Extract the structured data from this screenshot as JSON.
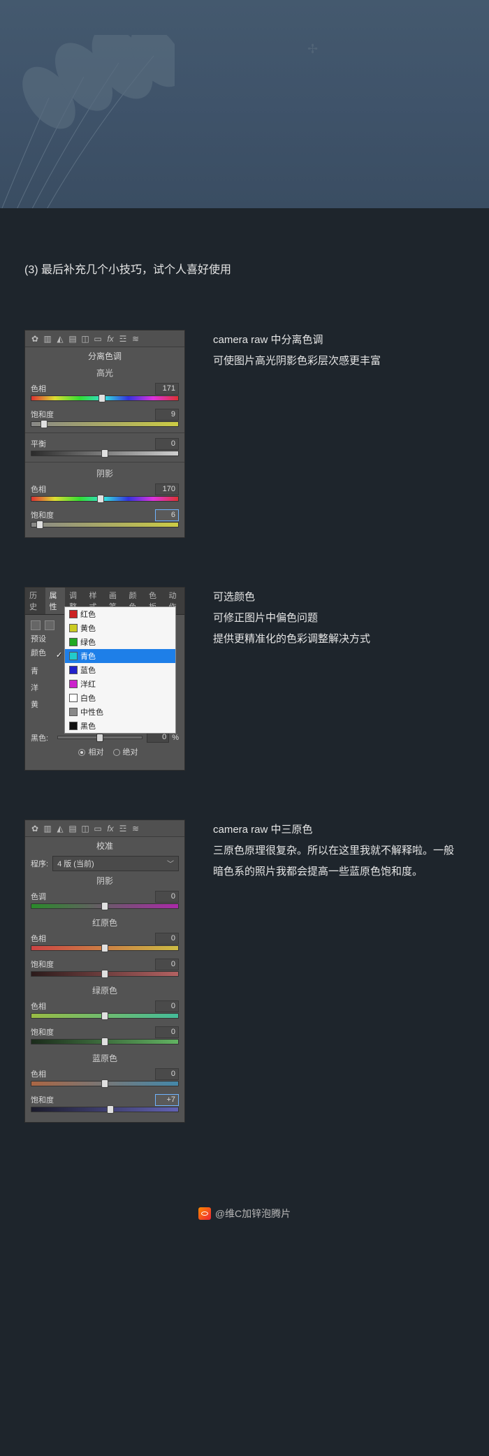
{
  "intro": "(3) 最后补充几个小技巧，试个人喜好使用",
  "split_toning_panel": {
    "title": "分离色调",
    "highlights_label": "高光",
    "shadows_label": "阴影",
    "hue_label": "色相",
    "saturation_label": "饱和度",
    "balance_label": "平衡",
    "highlight_hue": "171",
    "highlight_saturation": "9",
    "balance": "0",
    "shadow_hue": "170",
    "shadow_saturation": "6"
  },
  "split_toning_desc": {
    "line1": "camera raw 中分离色调",
    "line2": "可使图片高光阴影色彩层次感更丰富"
  },
  "selective_color_panel": {
    "tabs": [
      "历史",
      "属性",
      "调整",
      "样式",
      "画笔",
      "颜色",
      "色板",
      "动作"
    ],
    "active_tab": "属性",
    "preset_label": "预设",
    "color_row_label": "颜色",
    "options": [
      {
        "label": "红色",
        "swatch": "#cc2222"
      },
      {
        "label": "黄色",
        "swatch": "#cccc22"
      },
      {
        "label": "绿色",
        "swatch": "#22aa22"
      },
      {
        "label": "青色",
        "swatch": "#22cccc",
        "selected": true
      },
      {
        "label": "蓝色",
        "swatch": "#2222cc"
      },
      {
        "label": "洋红",
        "swatch": "#cc22cc"
      },
      {
        "label": "白色",
        "swatch": "#ffffff"
      },
      {
        "label": "中性色",
        "swatch": "#888888"
      },
      {
        "label": "黑色",
        "swatch": "#111111"
      }
    ],
    "black_label": "黑色:",
    "black_value": "0",
    "percent": "%",
    "mode_relative": "相对",
    "mode_absolute": "绝对"
  },
  "selective_color_desc": {
    "line1": "可选颜色",
    "line2": "可修正图片中偏色问题",
    "line3": "提供更精准化的色彩调整解决方式"
  },
  "calibration_panel": {
    "title": "校准",
    "process_label": "程序:",
    "process_value": "4 版 (当前)",
    "shadows_label": "阴影",
    "tint_label": "色调",
    "red_primary": "红原色",
    "green_primary": "绿原色",
    "blue_primary": "蓝原色",
    "hue_label": "色相",
    "sat_label": "饱和度",
    "shadow_tint": "0",
    "red_hue": "0",
    "red_sat": "0",
    "green_hue": "0",
    "green_sat": "0",
    "blue_hue": "0",
    "blue_sat": "+7"
  },
  "calibration_desc": {
    "line1": "camera raw 中三原色",
    "line2": "三原色原理很复杂。所以在这里我就不解释啦。一般暗色系的照片我都会提高一些蓝原色饱和度。"
  },
  "credit": "@维C加锌泡腾片"
}
